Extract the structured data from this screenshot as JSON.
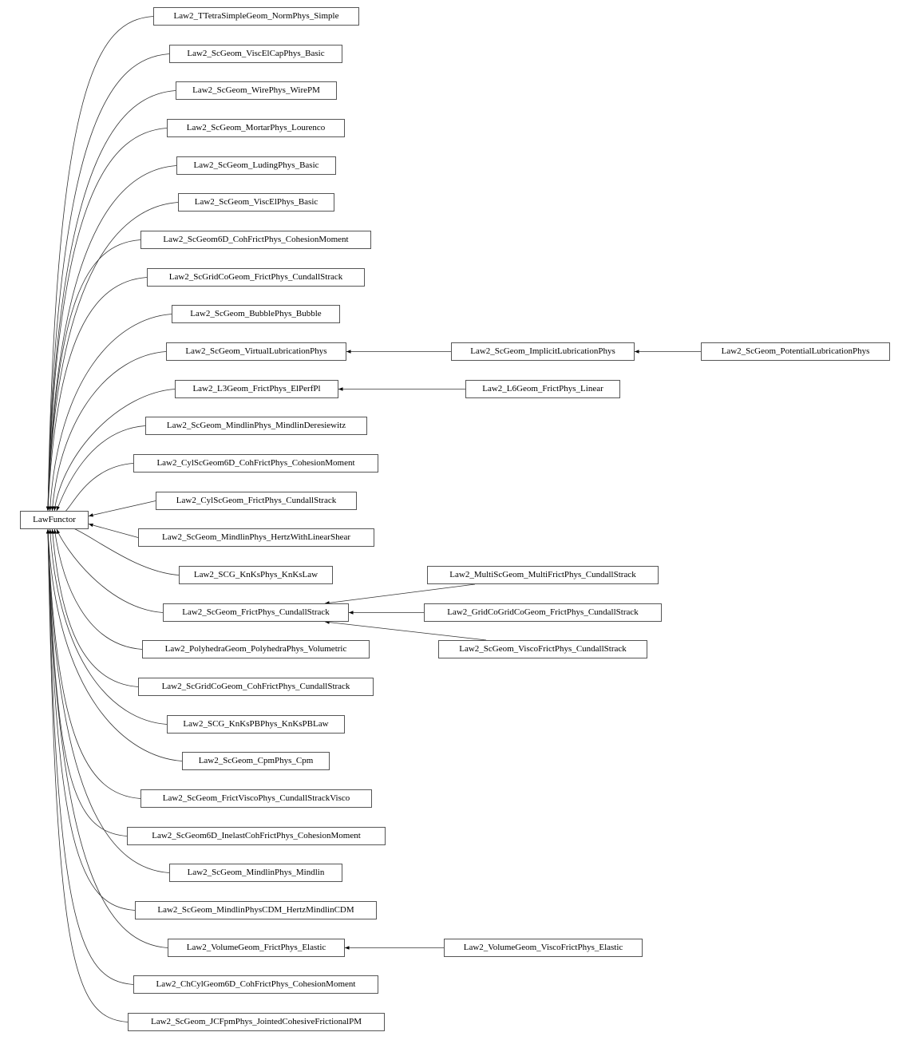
{
  "diagram": {
    "type": "class-inheritance-graph",
    "root": "LawFunctor",
    "nodes": [
      {
        "id": "LawFunctor",
        "label": "LawFunctor"
      },
      {
        "id": "n0",
        "label": "Law2_TTetraSimpleGeom_NormPhys_Simple"
      },
      {
        "id": "n1",
        "label": "Law2_ScGeom_ViscElCapPhys_Basic"
      },
      {
        "id": "n2",
        "label": "Law2_ScGeom_WirePhys_WirePM"
      },
      {
        "id": "n3",
        "label": "Law2_ScGeom_MortarPhys_Lourenco"
      },
      {
        "id": "n4",
        "label": "Law2_ScGeom_LudingPhys_Basic"
      },
      {
        "id": "n5",
        "label": "Law2_ScGeom_ViscElPhys_Basic"
      },
      {
        "id": "n6",
        "label": "Law2_ScGeom6D_CohFrictPhys_CohesionMoment"
      },
      {
        "id": "n7",
        "label": "Law2_ScGridCoGeom_FrictPhys_CundallStrack"
      },
      {
        "id": "n8",
        "label": "Law2_ScGeom_BubblePhys_Bubble"
      },
      {
        "id": "n9",
        "label": "Law2_ScGeom_VirtualLubricationPhys"
      },
      {
        "id": "n10",
        "label": "Law2_L3Geom_FrictPhys_ElPerfPl"
      },
      {
        "id": "n11",
        "label": "Law2_ScGeom_MindlinPhys_MindlinDeresiewitz"
      },
      {
        "id": "n12",
        "label": "Law2_CylScGeom6D_CohFrictPhys_CohesionMoment"
      },
      {
        "id": "n13",
        "label": "Law2_CylScGeom_FrictPhys_CundallStrack"
      },
      {
        "id": "n14",
        "label": "Law2_ScGeom_MindlinPhys_HertzWithLinearShear"
      },
      {
        "id": "n15",
        "label": "Law2_SCG_KnKsPhys_KnKsLaw"
      },
      {
        "id": "n16",
        "label": "Law2_ScGeom_FrictPhys_CundallStrack"
      },
      {
        "id": "n17",
        "label": "Law2_PolyhedraGeom_PolyhedraPhys_Volumetric"
      },
      {
        "id": "n18",
        "label": "Law2_ScGridCoGeom_CohFrictPhys_CundallStrack"
      },
      {
        "id": "n19",
        "label": "Law2_SCG_KnKsPBPhys_KnKsPBLaw"
      },
      {
        "id": "n20",
        "label": "Law2_ScGeom_CpmPhys_Cpm"
      },
      {
        "id": "n21",
        "label": "Law2_ScGeom_FrictViscoPhys_CundallStrackVisco"
      },
      {
        "id": "n22",
        "label": "Law2_ScGeom6D_InelastCohFrictPhys_CohesionMoment"
      },
      {
        "id": "n23",
        "label": "Law2_ScGeom_MindlinPhys_Mindlin"
      },
      {
        "id": "n24",
        "label": "Law2_ScGeom_MindlinPhysCDM_HertzMindlinCDM"
      },
      {
        "id": "n25",
        "label": "Law2_VolumeGeom_FrictPhys_Elastic"
      },
      {
        "id": "n26",
        "label": "Law2_ChCylGeom6D_CohFrictPhys_CohesionMoment"
      },
      {
        "id": "n27",
        "label": "Law2_ScGeom_JCFpmPhys_JointedCohesiveFrictionalPM"
      },
      {
        "id": "m1",
        "label": "Law2_ScGeom_ImplicitLubricationPhys"
      },
      {
        "id": "m2",
        "label": "Law2_ScGeom_PotentialLubricationPhys"
      },
      {
        "id": "m3",
        "label": "Law2_L6Geom_FrictPhys_Linear"
      },
      {
        "id": "m4",
        "label": "Law2_MultiScGeom_MultiFrictPhys_CundallStrack"
      },
      {
        "id": "m5",
        "label": "Law2_GridCoGridCoGeom_FrictPhys_CundallStrack"
      },
      {
        "id": "m6",
        "label": "Law2_ScGeom_ViscoFrictPhys_CundallStrack"
      },
      {
        "id": "m7",
        "label": "Law2_VolumeGeom_ViscoFrictPhys_Elastic"
      }
    ],
    "edges": [
      {
        "from": "n0",
        "to": "LawFunctor"
      },
      {
        "from": "n1",
        "to": "LawFunctor"
      },
      {
        "from": "n2",
        "to": "LawFunctor"
      },
      {
        "from": "n3",
        "to": "LawFunctor"
      },
      {
        "from": "n4",
        "to": "LawFunctor"
      },
      {
        "from": "n5",
        "to": "LawFunctor"
      },
      {
        "from": "n6",
        "to": "LawFunctor"
      },
      {
        "from": "n7",
        "to": "LawFunctor"
      },
      {
        "from": "n8",
        "to": "LawFunctor"
      },
      {
        "from": "n9",
        "to": "LawFunctor"
      },
      {
        "from": "n10",
        "to": "LawFunctor"
      },
      {
        "from": "n11",
        "to": "LawFunctor"
      },
      {
        "from": "n12",
        "to": "LawFunctor"
      },
      {
        "from": "n13",
        "to": "LawFunctor"
      },
      {
        "from": "n14",
        "to": "LawFunctor"
      },
      {
        "from": "n15",
        "to": "LawFunctor"
      },
      {
        "from": "n16",
        "to": "LawFunctor"
      },
      {
        "from": "n17",
        "to": "LawFunctor"
      },
      {
        "from": "n18",
        "to": "LawFunctor"
      },
      {
        "from": "n19",
        "to": "LawFunctor"
      },
      {
        "from": "n20",
        "to": "LawFunctor"
      },
      {
        "from": "n21",
        "to": "LawFunctor"
      },
      {
        "from": "n22",
        "to": "LawFunctor"
      },
      {
        "from": "n23",
        "to": "LawFunctor"
      },
      {
        "from": "n24",
        "to": "LawFunctor"
      },
      {
        "from": "n25",
        "to": "LawFunctor"
      },
      {
        "from": "n26",
        "to": "LawFunctor"
      },
      {
        "from": "n27",
        "to": "LawFunctor"
      },
      {
        "from": "m1",
        "to": "n9"
      },
      {
        "from": "m2",
        "to": "m1"
      },
      {
        "from": "m3",
        "to": "n10"
      },
      {
        "from": "m4",
        "to": "n16"
      },
      {
        "from": "m5",
        "to": "n16"
      },
      {
        "from": "m6",
        "to": "n16"
      },
      {
        "from": "m7",
        "to": "n25"
      }
    ]
  }
}
